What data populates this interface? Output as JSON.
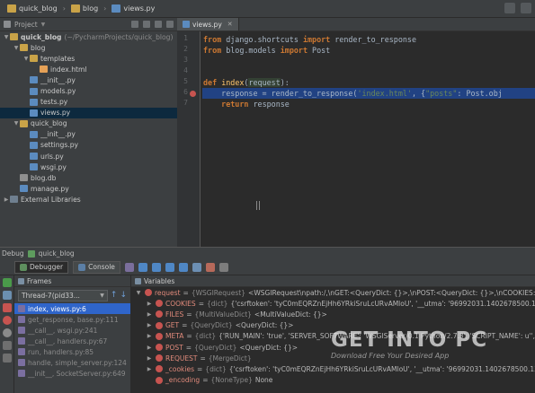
{
  "breadcrumbs": [
    "quick_blog",
    "blog",
    "views.py"
  ],
  "project_panel": {
    "title": "Project"
  },
  "tree": [
    {
      "label": "quick_blog",
      "path": "(~/PycharmProjects/quick_blog)",
      "type": "folder",
      "indent": 0,
      "arrow": "▼"
    },
    {
      "label": "blog",
      "type": "folder",
      "indent": 1,
      "arrow": "▼"
    },
    {
      "label": "templates",
      "type": "folder",
      "indent": 2,
      "arrow": "▼"
    },
    {
      "label": "index.html",
      "type": "html",
      "indent": 3,
      "arrow": ""
    },
    {
      "label": "__init__.py",
      "type": "py",
      "indent": 2,
      "arrow": ""
    },
    {
      "label": "models.py",
      "type": "py",
      "indent": 2,
      "arrow": ""
    },
    {
      "label": "tests.py",
      "type": "py",
      "indent": 2,
      "arrow": ""
    },
    {
      "label": "views.py",
      "type": "py",
      "indent": 2,
      "arrow": "",
      "selected": true
    },
    {
      "label": "quick_blog",
      "type": "folder",
      "indent": 1,
      "arrow": "▼"
    },
    {
      "label": "__init__.py",
      "type": "py",
      "indent": 2,
      "arrow": ""
    },
    {
      "label": "settings.py",
      "type": "py",
      "indent": 2,
      "arrow": ""
    },
    {
      "label": "urls.py",
      "type": "py",
      "indent": 2,
      "arrow": ""
    },
    {
      "label": "wsgi.py",
      "type": "py",
      "indent": 2,
      "arrow": ""
    },
    {
      "label": "blog.db",
      "type": "db",
      "indent": 1,
      "arrow": ""
    },
    {
      "label": "manage.py",
      "type": "py",
      "indent": 1,
      "arrow": ""
    },
    {
      "label": "External Libraries",
      "type": "lib",
      "indent": 0,
      "arrow": "▶"
    }
  ],
  "editor": {
    "tab": "views.py",
    "lines": [
      {
        "n": "1",
        "html": "<span class='kw'>from</span> django.shortcuts <span class='kw'>import</span> render_to_response"
      },
      {
        "n": "2",
        "html": "<span class='kw'>from</span> blog.models <span class='kw'>import</span> Post"
      },
      {
        "n": "3",
        "html": ""
      },
      {
        "n": "4",
        "html": ""
      },
      {
        "n": "5",
        "html": "<span class='kw'>def</span> <span class='fn'>index</span>(<span class='cur'>request</span>):"
      },
      {
        "n": "6",
        "html": "    response = render_to_response(<span class='str'>'index.html'</span>, {<span class='str'>\"posts\"</span>: Post.obj",
        "highlight": true,
        "breakpoint": true
      },
      {
        "n": "7",
        "html": "    <span class='kw'>return</span> response"
      }
    ]
  },
  "debug": {
    "title": "Debug",
    "config": "quick_blog",
    "tabs": [
      "Debugger",
      "Console"
    ],
    "frames_title": "Frames",
    "variables_title": "Variables",
    "thread": "Thread-7(pid33...",
    "frames": [
      {
        "label": "index, views.py:6",
        "selected": true
      },
      {
        "label": "get_response, base.py:111"
      },
      {
        "label": "__call__, wsgi.py:241"
      },
      {
        "label": "__call__, handlers.py:67"
      },
      {
        "label": "run, handlers.py:85"
      },
      {
        "label": "handle, simple_server.py:124"
      },
      {
        "label": "__init__, SocketServer.py:649"
      }
    ],
    "variables": [
      {
        "name": "request",
        "type": "{WSGIRequest}",
        "value": "<WSGIRequest\\npath:/,\\nGET:<QueryDict: {}>,\\nPOST:<QueryDict: {}>,\\nCOOKIES:{'__utma': '969920",
        "indent": 0,
        "arrow": "▼"
      },
      {
        "name": "COOKIES",
        "type": "{dict}",
        "value": "{'csrftoken': 'tyC0mEQRZnEjHh6YRkiSruLcURvAMloU', '__utma': '96992031.1402678500.1355723508.136148",
        "indent": 1,
        "arrow": "▶"
      },
      {
        "name": "FILES",
        "type": "{MultiValueDict}",
        "value": "<MultiValueDict: {}>",
        "indent": 1,
        "arrow": "▶"
      },
      {
        "name": "GET",
        "type": "{QueryDict}",
        "value": "<QueryDict: {}>",
        "indent": 1,
        "arrow": "▶"
      },
      {
        "name": "META",
        "type": "{dict}",
        "value": "{'RUN_MAIN': 'true', 'SERVER_SOFTWARE': 'WSGIServer/0.1 Python/2.7.3', 'SCRIPT_NAME': u'', 'REQUEST_M",
        "indent": 1,
        "arrow": "▶"
      },
      {
        "name": "POST",
        "type": "{QueryDict}",
        "value": "<QueryDict: {}>",
        "indent": 1,
        "arrow": "▶"
      },
      {
        "name": "REQUEST",
        "type": "{MergeDict}",
        "value": "",
        "indent": 1,
        "arrow": "▶"
      },
      {
        "name": "_cookies",
        "type": "{dict}",
        "value": "{'csrftoken': 'tyC0mEQRZnEjHh6YRkiSruLcURvAMloU', '__utma': '96992031.1402678500.1355723508.136148",
        "indent": 1,
        "arrow": "▶"
      },
      {
        "name": "_encoding",
        "type": "{NoneType}",
        "value": "None",
        "indent": 1,
        "arrow": ""
      }
    ]
  },
  "watermark": {
    "text": "GET INTO PC",
    "sub": "Download Free Your Desired App"
  },
  "colors": {
    "selection": "#2f65ca",
    "breakpoint": "#c75450",
    "keyword": "#cc7832",
    "string": "#6a8759"
  }
}
